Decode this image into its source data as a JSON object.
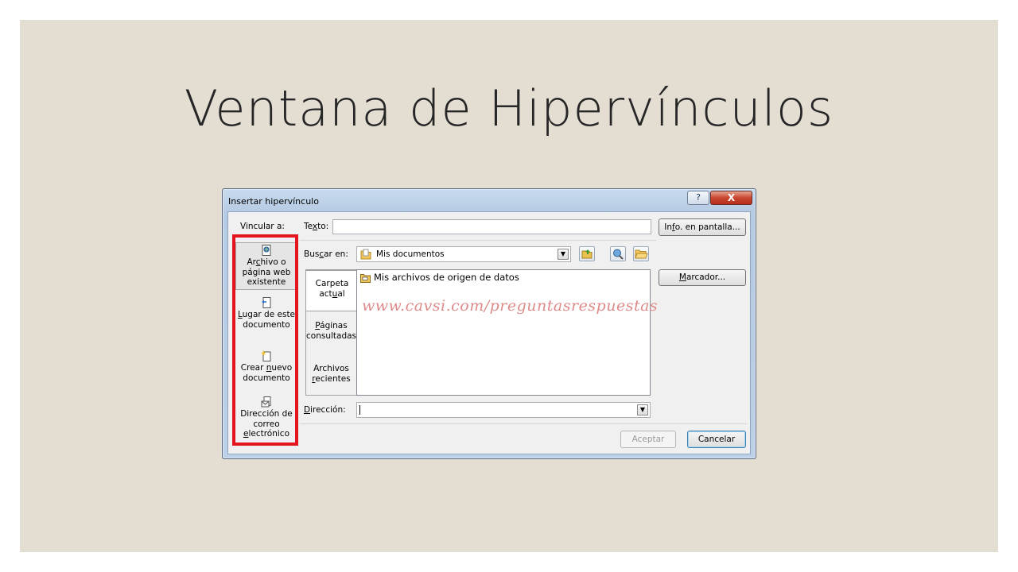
{
  "slide": {
    "title": "Ventana de Hipervínculos"
  },
  "dialog": {
    "title": "Insertar hipervínculo",
    "help_label": "?",
    "close_label": "X",
    "vincular_label": "Vincular a:",
    "texto_label": "Texto:",
    "texto_value": "",
    "info_button": "Info. en pantalla...",
    "buscar_label": "Buscar en:",
    "buscar_value": "Mis documentos",
    "marcador_button": "Marcador...",
    "direccion_label": "Dirección:",
    "direccion_value": "",
    "aceptar_button": "Aceptar",
    "cancelar_button": "Cancelar",
    "nav_items": [
      {
        "label": "Archivo o página web existente",
        "icon": "web-page-icon",
        "selected": true
      },
      {
        "label": "Lugar de este documento",
        "icon": "document-place-icon",
        "selected": false
      },
      {
        "label": "Crear nuevo documento",
        "icon": "new-document-icon",
        "selected": false
      },
      {
        "label": "Dirección de correo electrónico",
        "icon": "email-icon",
        "selected": false
      }
    ],
    "sub_tabs": [
      {
        "label": "Carpeta actual",
        "selected": true
      },
      {
        "label": "Páginas consultadas",
        "selected": false
      },
      {
        "label": "Archivos recientes",
        "selected": false
      }
    ],
    "file_list": [
      "Mis archivos de origen de datos"
    ],
    "watermark": "www.cavsi.com/preguntasrespuestas"
  },
  "colors": {
    "highlight": "#e5151d",
    "slide_background": "#e3ddd2"
  }
}
